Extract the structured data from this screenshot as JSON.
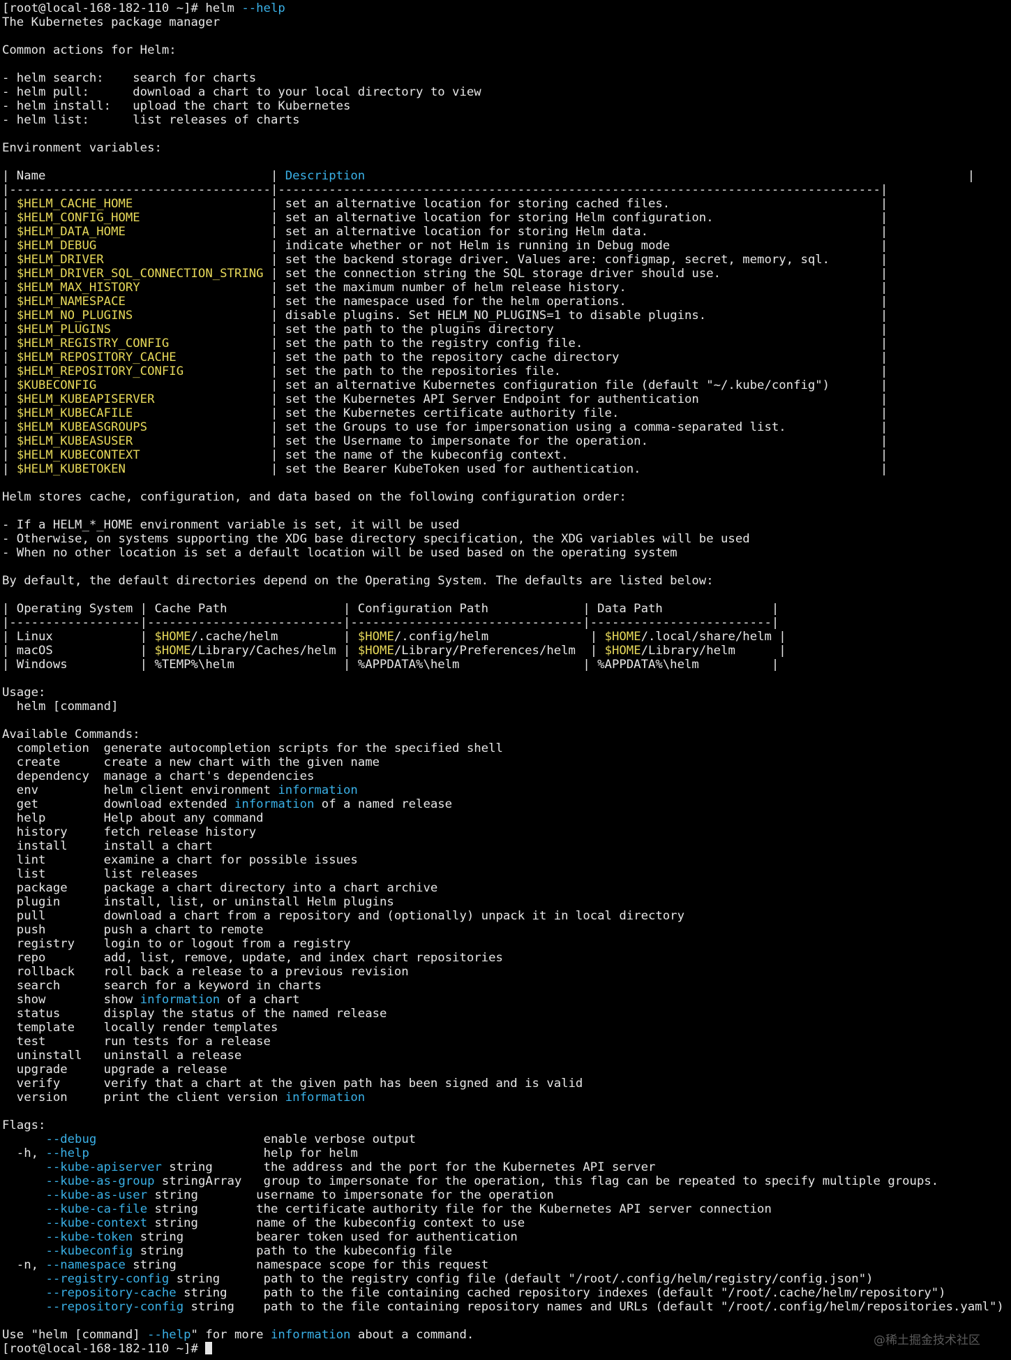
{
  "terminal": {
    "lines": [
      [
        {
          "t": "[root@local-168-182-110 ~]# helm "
        },
        {
          "t": "--help",
          "c": "c"
        }
      ],
      [
        {
          "t": "The Kubernetes package manager"
        }
      ],
      [],
      [
        {
          "t": "Common actions for Helm:"
        }
      ],
      [],
      [
        {
          "t": "- helm search:    search for charts"
        }
      ],
      [
        {
          "t": "- helm pull:      download a chart to your local directory to view"
        }
      ],
      [
        {
          "t": "- helm install:   upload the chart to Kubernetes"
        }
      ],
      [
        {
          "t": "- helm list:      list releases of charts"
        }
      ],
      [],
      [
        {
          "t": "Environment variables:"
        }
      ],
      [],
      [
        {
          "t": "| Name                               | "
        },
        {
          "t": "Description",
          "c": "c"
        },
        {
          "t": "                                                                                   |"
        }
      ],
      [
        {
          "t": "|------------------------------------|-----------------------------------------------------------------------------------|"
        }
      ],
      [
        {
          "t": "| "
        },
        {
          "t": "$HELM_CACHE_HOME",
          "c": "y"
        },
        {
          "t": "                   | set an alternative location for storing cached files.                             |"
        }
      ],
      [
        {
          "t": "| "
        },
        {
          "t": "$HELM_CONFIG_HOME",
          "c": "y"
        },
        {
          "t": "                  | set an alternative location for storing Helm configuration.                       |"
        }
      ],
      [
        {
          "t": "| "
        },
        {
          "t": "$HELM_DATA_HOME",
          "c": "y"
        },
        {
          "t": "                    | set an alternative location for storing Helm data.                                |"
        }
      ],
      [
        {
          "t": "| "
        },
        {
          "t": "$HELM_DEBUG",
          "c": "y"
        },
        {
          "t": "                        | indicate whether or not Helm is running in Debug mode                             |"
        }
      ],
      [
        {
          "t": "| "
        },
        {
          "t": "$HELM_DRIVER",
          "c": "y"
        },
        {
          "t": "                       | set the backend storage driver. Values are: configmap, secret, memory, sql.       |"
        }
      ],
      [
        {
          "t": "| "
        },
        {
          "t": "$HELM_DRIVER_SQL_CONNECTION_STRING",
          "c": "y"
        },
        {
          "t": " | set the connection string the SQL storage driver should use.                      |"
        }
      ],
      [
        {
          "t": "| "
        },
        {
          "t": "$HELM_MAX_HISTORY",
          "c": "y"
        },
        {
          "t": "                  | set the maximum number of helm release history.                                   |"
        }
      ],
      [
        {
          "t": "| "
        },
        {
          "t": "$HELM_NAMESPACE",
          "c": "y"
        },
        {
          "t": "                    | set the namespace used for the helm operations.                                   |"
        }
      ],
      [
        {
          "t": "| "
        },
        {
          "t": "$HELM_NO_PLUGINS",
          "c": "y"
        },
        {
          "t": "                   | disable plugins. Set HELM_NO_PLUGINS=1 to disable plugins.                        |"
        }
      ],
      [
        {
          "t": "| "
        },
        {
          "t": "$HELM_PLUGINS",
          "c": "y"
        },
        {
          "t": "                      | set the path to the plugins directory                                             |"
        }
      ],
      [
        {
          "t": "| "
        },
        {
          "t": "$HELM_REGISTRY_CONFIG",
          "c": "y"
        },
        {
          "t": "              | set the path to the registry config file.                                         |"
        }
      ],
      [
        {
          "t": "| "
        },
        {
          "t": "$HELM_REPOSITORY_CACHE",
          "c": "y"
        },
        {
          "t": "             | set the path to the repository cache directory                                    |"
        }
      ],
      [
        {
          "t": "| "
        },
        {
          "t": "$HELM_REPOSITORY_CONFIG",
          "c": "y"
        },
        {
          "t": "            | set the path to the repositories file.                                            |"
        }
      ],
      [
        {
          "t": "| "
        },
        {
          "t": "$KUBECONFIG",
          "c": "y"
        },
        {
          "t": "                        | set an alternative Kubernetes configuration file (default \"~/.kube/config\")       |"
        }
      ],
      [
        {
          "t": "| "
        },
        {
          "t": "$HELM_KUBEAPISERVER",
          "c": "y"
        },
        {
          "t": "                | set the Kubernetes API Server Endpoint for authentication                         |"
        }
      ],
      [
        {
          "t": "| "
        },
        {
          "t": "$HELM_KUBECAFILE",
          "c": "y"
        },
        {
          "t": "                   | set the Kubernetes certificate authority file.                                    |"
        }
      ],
      [
        {
          "t": "| "
        },
        {
          "t": "$HELM_KUBEASGROUPS",
          "c": "y"
        },
        {
          "t": "                 | set the Groups to use for impersonation using a comma-separated list.             |"
        }
      ],
      [
        {
          "t": "| "
        },
        {
          "t": "$HELM_KUBEASUSER",
          "c": "y"
        },
        {
          "t": "                   | set the Username to impersonate for the operation.                                |"
        }
      ],
      [
        {
          "t": "| "
        },
        {
          "t": "$HELM_KUBECONTEXT",
          "c": "y"
        },
        {
          "t": "                  | set the name of the kubeconfig context.                                           |"
        }
      ],
      [
        {
          "t": "| "
        },
        {
          "t": "$HELM_KUBETOKEN",
          "c": "y"
        },
        {
          "t": "                    | set the Bearer KubeToken used for authentication.                                 |"
        }
      ],
      [],
      [
        {
          "t": "Helm stores cache, configuration, and data based on the following configuration order:"
        }
      ],
      [],
      [
        {
          "t": "- If a HELM_*_HOME environment variable is set, it will be used"
        }
      ],
      [
        {
          "t": "- Otherwise, on systems supporting the XDG base directory specification, the XDG variables will be used"
        }
      ],
      [
        {
          "t": "- When no other location is set a default location will be used based on the operating system"
        }
      ],
      [],
      [
        {
          "t": "By default, the default directories depend on the Operating System. The defaults are listed below:"
        }
      ],
      [],
      [
        {
          "t": "| Operating System | Cache Path                | Configuration Path             | Data Path               |"
        }
      ],
      [
        {
          "t": "|------------------|---------------------------|--------------------------------|-------------------------|"
        }
      ],
      [
        {
          "t": "| Linux            | "
        },
        {
          "t": "$HOME",
          "c": "y"
        },
        {
          "t": "/.cache/helm         | "
        },
        {
          "t": "$HOME",
          "c": "y"
        },
        {
          "t": "/.config/helm              | "
        },
        {
          "t": "$HOME",
          "c": "y"
        },
        {
          "t": "/.local/share/helm |"
        }
      ],
      [
        {
          "t": "| macOS            | "
        },
        {
          "t": "$HOME",
          "c": "y"
        },
        {
          "t": "/Library/Caches/helm | "
        },
        {
          "t": "$HOME",
          "c": "y"
        },
        {
          "t": "/Library/Preferences/helm  | "
        },
        {
          "t": "$HOME",
          "c": "y"
        },
        {
          "t": "/Library/helm      |"
        }
      ],
      [
        {
          "t": "| Windows          | %TEMP%\\helm               | %APPDATA%\\helm                 | %APPDATA%\\helm          |"
        }
      ],
      [],
      [
        {
          "t": "Usage:"
        }
      ],
      [
        {
          "t": "  helm [command]"
        }
      ],
      [],
      [
        {
          "t": "Available Commands:"
        }
      ],
      [
        {
          "t": "  completion  generate autocompletion scripts for the specified shell"
        }
      ],
      [
        {
          "t": "  create      create a new chart with the given name"
        }
      ],
      [
        {
          "t": "  dependency  manage a chart's dependencies"
        }
      ],
      [
        {
          "t": "  env         helm client environment "
        },
        {
          "t": "information",
          "c": "c"
        }
      ],
      [
        {
          "t": "  get         download extended "
        },
        {
          "t": "information",
          "c": "c"
        },
        {
          "t": " of a named release"
        }
      ],
      [
        {
          "t": "  help        Help about any command"
        }
      ],
      [
        {
          "t": "  history     fetch release history"
        }
      ],
      [
        {
          "t": "  install     install a chart"
        }
      ],
      [
        {
          "t": "  lint        examine a chart for possible issues"
        }
      ],
      [
        {
          "t": "  list        list releases"
        }
      ],
      [
        {
          "t": "  package     package a chart directory into a chart archive"
        }
      ],
      [
        {
          "t": "  plugin      install, list, or uninstall Helm plugins"
        }
      ],
      [
        {
          "t": "  pull        download a chart from a repository and (optionally) unpack it in local directory"
        }
      ],
      [
        {
          "t": "  push        push a chart to remote"
        }
      ],
      [
        {
          "t": "  registry    login to or logout from a registry"
        }
      ],
      [
        {
          "t": "  repo        add, list, remove, update, and index chart repositories"
        }
      ],
      [
        {
          "t": "  rollback    roll back a release to a previous revision"
        }
      ],
      [
        {
          "t": "  search      search for a keyword in charts"
        }
      ],
      [
        {
          "t": "  show        show "
        },
        {
          "t": "information",
          "c": "c"
        },
        {
          "t": " of a chart"
        }
      ],
      [
        {
          "t": "  status      display the status of the named release"
        }
      ],
      [
        {
          "t": "  template    locally render templates"
        }
      ],
      [
        {
          "t": "  test        run tests for a release"
        }
      ],
      [
        {
          "t": "  uninstall   uninstall a release"
        }
      ],
      [
        {
          "t": "  upgrade     upgrade a release"
        }
      ],
      [
        {
          "t": "  verify      verify that a chart at the given path has been signed and is valid"
        }
      ],
      [
        {
          "t": "  version     print the client version "
        },
        {
          "t": "information",
          "c": "c"
        }
      ],
      [],
      [
        {
          "t": "Flags:"
        }
      ],
      [
        {
          "t": "      "
        },
        {
          "t": "--debug",
          "c": "c"
        },
        {
          "t": "                       enable verbose output"
        }
      ],
      [
        {
          "t": "  -h, "
        },
        {
          "t": "--help",
          "c": "c"
        },
        {
          "t": "                        help for helm"
        }
      ],
      [
        {
          "t": "      "
        },
        {
          "t": "--kube-apiserver",
          "c": "c"
        },
        {
          "t": " string       the address and the port for the Kubernetes API server"
        }
      ],
      [
        {
          "t": "      "
        },
        {
          "t": "--kube-as-group",
          "c": "c"
        },
        {
          "t": " stringArray   group to impersonate for the operation, this flag can be repeated to specify multiple groups."
        }
      ],
      [
        {
          "t": "      "
        },
        {
          "t": "--kube-as-user",
          "c": "c"
        },
        {
          "t": " string        username to impersonate for the operation"
        }
      ],
      [
        {
          "t": "      "
        },
        {
          "t": "--kube-ca-file",
          "c": "c"
        },
        {
          "t": " string        the certificate authority file for the Kubernetes API server connection"
        }
      ],
      [
        {
          "t": "      "
        },
        {
          "t": "--kube-context",
          "c": "c"
        },
        {
          "t": " string        name of the kubeconfig context to use"
        }
      ],
      [
        {
          "t": "      "
        },
        {
          "t": "--kube-token",
          "c": "c"
        },
        {
          "t": " string          bearer token used for authentication"
        }
      ],
      [
        {
          "t": "      "
        },
        {
          "t": "--kubeconfig",
          "c": "c"
        },
        {
          "t": " string          path to the kubeconfig file"
        }
      ],
      [
        {
          "t": "  -n, "
        },
        {
          "t": "--namespace",
          "c": "c"
        },
        {
          "t": " string           namespace scope for this request"
        }
      ],
      [
        {
          "t": "      "
        },
        {
          "t": "--registry-config",
          "c": "c"
        },
        {
          "t": " string      path to the registry config file (default \"/root/.config/helm/registry/config.json\")"
        }
      ],
      [
        {
          "t": "      "
        },
        {
          "t": "--repository-cache",
          "c": "c"
        },
        {
          "t": " string     path to the file containing cached repository indexes (default \"/root/.cache/helm/repository\")"
        }
      ],
      [
        {
          "t": "      "
        },
        {
          "t": "--repository-config",
          "c": "c"
        },
        {
          "t": " string    path to the file containing repository names and URLs (default \"/root/.config/helm/repositories.yaml\")"
        }
      ],
      [],
      [
        {
          "t": "Use \"helm [command] "
        },
        {
          "t": "--help",
          "c": "c"
        },
        {
          "t": "\" for more "
        },
        {
          "t": "information",
          "c": "c"
        },
        {
          "t": " about a command."
        }
      ],
      [
        {
          "t": "[root@local-168-182-110 ~]# "
        }
      ]
    ]
  },
  "watermark": "@稀土掘金技术社区",
  "colors": {
    "background": "#000000",
    "foreground": "#e6e6e6",
    "yellow_highlight": "#e7d95a",
    "cyan_highlight": "#3ab0e6"
  }
}
